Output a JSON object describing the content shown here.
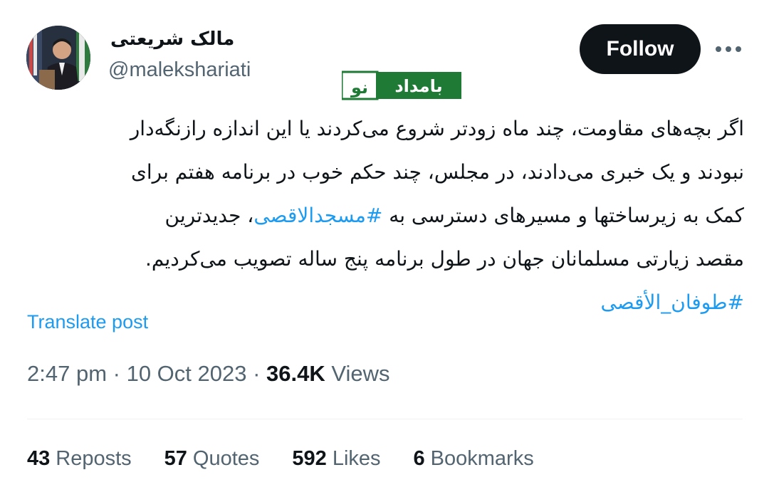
{
  "author": {
    "display_name": "مالک شریعتی",
    "handle": "@malekshariati"
  },
  "follow_label": "Follow",
  "watermark": {
    "left_text": "نو",
    "right_text": "بامداد"
  },
  "tweet": {
    "lines": [
      "اگر بچه‌های مقاومت، چند ماه زودتر شروع می‌کردند یا این اندازه رازنگه‌دار",
      "نبودند و یک خبری می‌دادند، در مجلس، چند حکم خوب در برنامه هفتم برای",
      "مقصد زیارتی مسلمانان جهان در طول برنامه پنج ساله تصویب می‌کردیم."
    ],
    "line3_before": "کمک به زیرساختها و مسیرهای دسترسی به ",
    "line3_hashtag": "#مسجدالاقصی",
    "line3_after": "، جدیدترین",
    "hashtag2": "#طوفان_الأقصى"
  },
  "translate_label": "Translate post",
  "meta": {
    "time": "2:47 pm",
    "date": "10 Oct 2023",
    "views_count": "36.4K",
    "views_label": "Views"
  },
  "stats": {
    "reposts_count": "43",
    "reposts_label": "Reposts",
    "quotes_count": "57",
    "quotes_label": "Quotes",
    "likes_count": "592",
    "likes_label": "Likes",
    "bookmarks_count": "6",
    "bookmarks_label": "Bookmarks"
  },
  "colors": {
    "link": "#1d9bf0",
    "secondary_text": "#536471",
    "button_bg": "#0f1419",
    "watermark_green": "#1f7a35"
  }
}
